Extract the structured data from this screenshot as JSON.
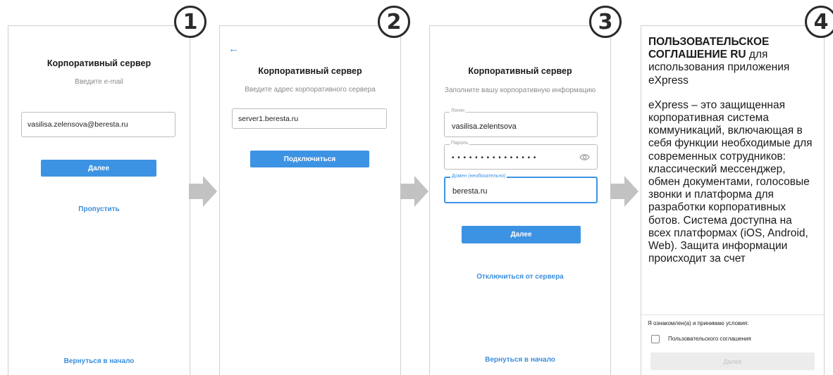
{
  "step_badges": [
    "1",
    "2",
    "3",
    "4"
  ],
  "screen1": {
    "title": "Корпоративный сервер",
    "hint": "Введите e-mail",
    "email_value": "vasilisa.zelensova@beresta.ru",
    "next_label": "Далее",
    "skip_label": "Пропустить",
    "back_to_start_label": "Вернуться в начало"
  },
  "screen2": {
    "back_icon": "←",
    "title": "Корпоративный сервер",
    "hint": "Введите адрес корпоративного сервера",
    "server_value": "server1.beresta.ru",
    "connect_label": "Подключиться"
  },
  "screen3": {
    "title": "Корпоративный сервер",
    "hint": "Заполните вашу корпоративную информацию",
    "login_label": "Логин",
    "login_value": "vasilisa.zelentsova",
    "password_label": "Пароль",
    "password_value": "• • • • • • • • • • • • • • •",
    "domain_label": "Домен (необязательно)",
    "domain_value": "beresta.ru",
    "next_label": "Далее",
    "disconnect_label": "Отключиться от сервера",
    "back_to_start_label": "Вернуться в начало"
  },
  "screen4": {
    "heading_bold": "ПОЛЬЗОВАТЕЛЬСКОЕ СОГЛАШЕНИЕ RU",
    "heading_rest": " для использования приложения eXpress",
    "body_text": "eXpress – это защищенная корпоративная система коммуникаций, включающая в себя функции необходимые для современных сотрудников: классический мессенджер, обмен документами, голосовые звонки и платформа для разработки корпоративных ботов. Система доступна на всех платформах (iOS, Android, Web). Защита информации происходит за счет",
    "accept_prompt": "Я ознакомлен(а) и принимаю условия:",
    "checkbox_label": "Пользовательского соглашения",
    "next_label": "Далее"
  },
  "colors": {
    "accent": "#3d93e3",
    "link": "#3c8fdd",
    "arrow": "#c2c2c2",
    "disabled": "#ececec"
  },
  "icons": [
    "eye-icon",
    "back-arrow-icon",
    "step-arrow-icon",
    "checkbox-icon"
  ]
}
